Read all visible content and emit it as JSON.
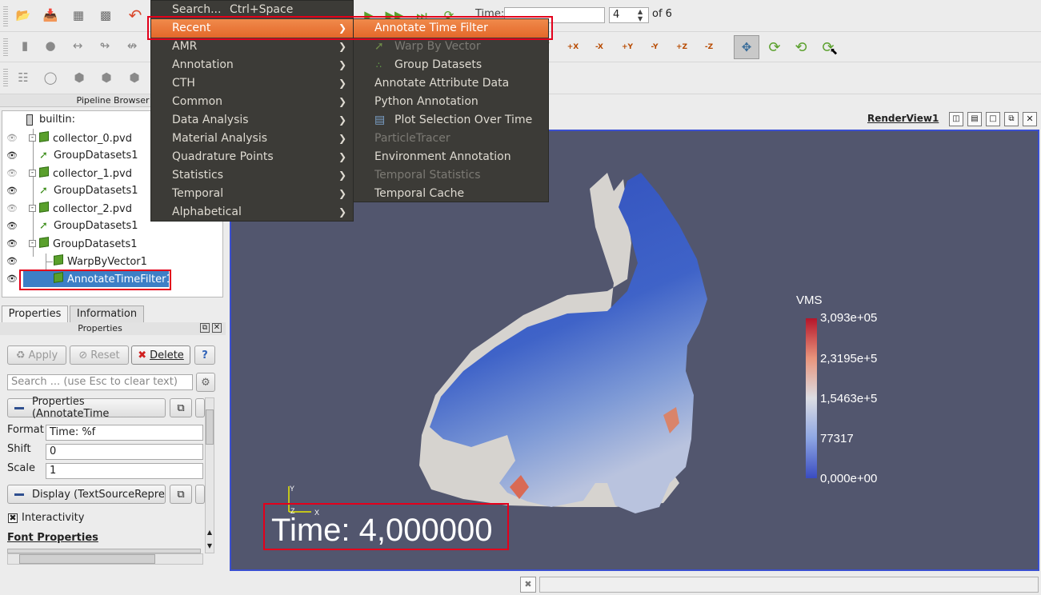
{
  "time_toolbar": {
    "label": "Time:",
    "time_value": "",
    "step_value": "4",
    "of_label": "of 6"
  },
  "pipeline_browser": {
    "title": "Pipeline Browser",
    "items": [
      {
        "label": "builtin:"
      },
      {
        "label": "collector_0.pvd"
      },
      {
        "label": "GroupDatasets1"
      },
      {
        "label": "collector_1.pvd"
      },
      {
        "label": "GroupDatasets1"
      },
      {
        "label": "collector_2.pvd"
      },
      {
        "label": "GroupDatasets1"
      },
      {
        "label": "GroupDatasets1"
      },
      {
        "label": "WarpByVector1"
      },
      {
        "label": "AnnotateTimeFilter1"
      }
    ]
  },
  "properties_panel": {
    "tabs": [
      {
        "label": "Properties"
      },
      {
        "label": "Information"
      }
    ],
    "title": "Properties",
    "apply_label": "Apply",
    "reset_label": "Reset",
    "delete_label": "Delete",
    "help_label": "?",
    "search_placeholder": "Search ... (use Esc to clear text)",
    "section_properties": "Properties (AnnotateTime",
    "format_label": "Format",
    "format_value": "Time: %f",
    "shift_label": "Shift",
    "shift_value": "0",
    "scale_label": "Scale",
    "scale_value": "1",
    "section_display": "Display (TextSourceRepre",
    "interactivity_label": "Interactivity",
    "font_properties_label": "Font Properties"
  },
  "render_view": {
    "title": "RenderView1",
    "time_annotation": "Time: 4,000000",
    "legend": {
      "title": "VMS",
      "ticks": [
        "3,093e+05",
        "2,3195e+5",
        "1,5463e+5",
        "77317",
        "0,000e+00"
      ]
    },
    "axes": {
      "y": "Y",
      "z": "Z",
      "x": "X"
    }
  },
  "filters_menu": {
    "items": [
      {
        "label": "Search...",
        "shortcut": "Ctrl+Space"
      },
      {
        "label": "Recent"
      },
      {
        "label": "AMR"
      },
      {
        "label": "Annotation"
      },
      {
        "label": "CTH"
      },
      {
        "label": "Common"
      },
      {
        "label": "Data Analysis"
      },
      {
        "label": "Material Analysis"
      },
      {
        "label": "Quadrature Points"
      },
      {
        "label": "Statistics"
      },
      {
        "label": "Temporal"
      },
      {
        "label": "Alphabetical"
      }
    ]
  },
  "recent_submenu": {
    "items": [
      {
        "label": "Annotate Time Filter"
      },
      {
        "label": "Warp By Vector"
      },
      {
        "label": "Group Datasets"
      },
      {
        "label": "Annotate Attribute Data"
      },
      {
        "label": "Python Annotation"
      },
      {
        "label": "Plot Selection Over Time"
      },
      {
        "label": "ParticleTracer"
      },
      {
        "label": "Environment Annotation"
      },
      {
        "label": "Temporal Statistics"
      },
      {
        "label": "Temporal Cache"
      }
    ]
  },
  "camera_toolbar": {
    "buttons": [
      {
        "label": "+X"
      },
      {
        "label": "-X"
      },
      {
        "label": "+Y"
      },
      {
        "label": "-Y"
      },
      {
        "label": "+Z"
      },
      {
        "label": "-Z"
      }
    ]
  },
  "colors": {
    "menu_bg": "#3c3b37",
    "menu_highlight": "#e8702f",
    "render_bg": "#52566e",
    "highlight_box": "#e3001b"
  }
}
